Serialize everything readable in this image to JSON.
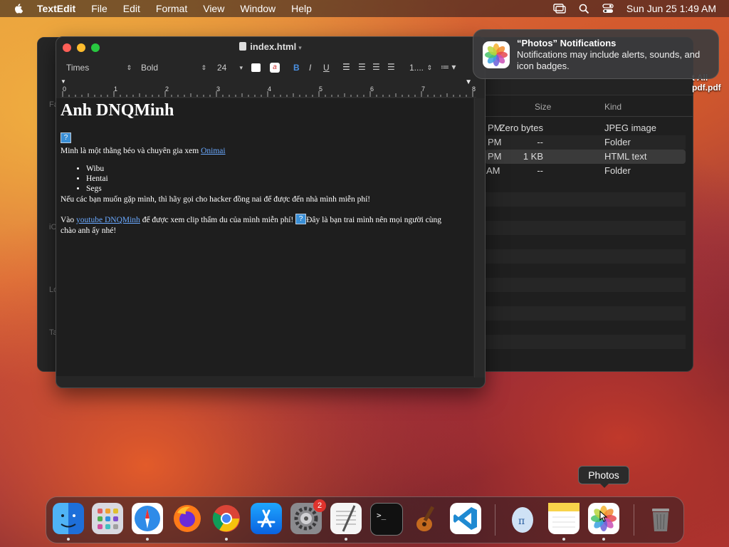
{
  "menubar": {
    "app": "TextEdit",
    "items": [
      "File",
      "Edit",
      "Format",
      "View",
      "Window",
      "Help"
    ],
    "clock": "Sun Jun 25  1:49 AM"
  },
  "finder": {
    "columns": {
      "size": "Size",
      "kind": "Kind"
    },
    "rows": [
      {
        "date": "PM",
        "size": "Zero bytes",
        "kind": "JPEG image"
      },
      {
        "date": "PM",
        "size": "--",
        "kind": "Folder"
      },
      {
        "date": "PM",
        "size": "1 KB",
        "kind": "HTML text"
      },
      {
        "date": "AM",
        "size": "--",
        "kind": "Folder"
      }
    ],
    "sidebar_fragments": [
      "Fa",
      "iC",
      "Lo",
      "Ta"
    ]
  },
  "textedit": {
    "title": "index.html",
    "font_family": "Times",
    "font_style": "Bold",
    "font_size": "24",
    "spacing": "1....",
    "bold": "B",
    "italic": "I",
    "underline": "U",
    "ruler": [
      "0",
      "1",
      "2",
      "3",
      "4",
      "5",
      "6",
      "7",
      "8"
    ],
    "doc": {
      "heading": "Anh DNQMinh",
      "broken_image": "?",
      "intro": "Minh là một thằng béo và chuyên gia xem ",
      "intro_link": "Onimai",
      "list": [
        "Wibu",
        "Hentai",
        "Segs"
      ],
      "para1": "Nếu các bạn muốn gặp mình, thì hãy gọi cho hacker đồng nai để được đến nhà mình miễn phí!",
      "para2_a": "Vào ",
      "para2_link": "youtube DNQMinh",
      "para2_b": " để được xem clip thẩm du của mình miễn phí! ",
      "para2_c": "Đây là bạn trai mình nên mọi người cùng",
      "para2_d": "chào anh ấy nhé!"
    }
  },
  "notification": {
    "title": "“Photos” Notifications",
    "body": "Notifications may include alerts, sounds, and icon badges."
  },
  "desktop_file": {
    "line1": "t All",
    "line2": "pdf.pdf"
  },
  "dock": {
    "tooltip": "Photos",
    "badge": "2",
    "apps": [
      "finder",
      "launchpad",
      "safari",
      "firefox",
      "chrome",
      "app-store",
      "system-settings",
      "textedit",
      "terminal",
      "garageband",
      "vscode",
      "preview",
      "notes",
      "photos",
      "trash"
    ]
  },
  "colors": {
    "accent": "#3a8fd6",
    "link": "#6aa9ff",
    "badge": "#e0332d"
  }
}
